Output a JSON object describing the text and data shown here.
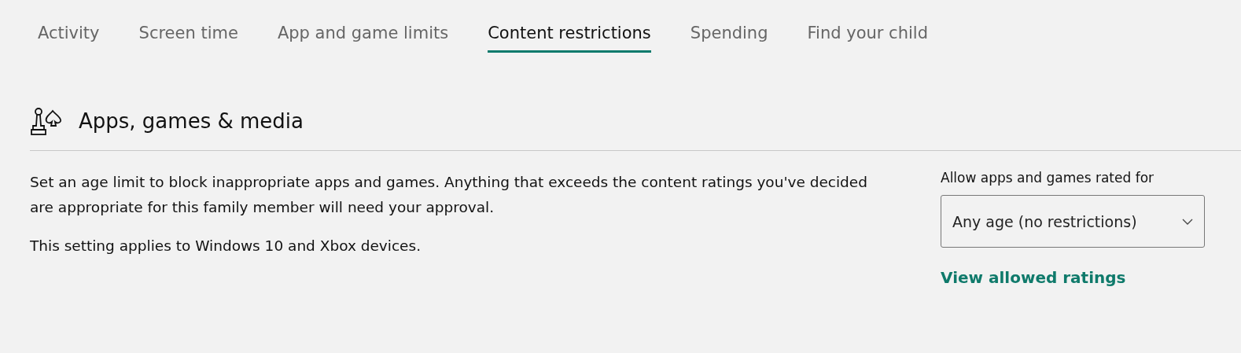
{
  "tabs": [
    {
      "label": "Activity",
      "selected": false
    },
    {
      "label": "Screen time",
      "selected": false
    },
    {
      "label": "App and game limits",
      "selected": false
    },
    {
      "label": "Content restrictions",
      "selected": true
    },
    {
      "label": "Spending",
      "selected": false
    },
    {
      "label": "Find your child",
      "selected": false
    }
  ],
  "section": {
    "title": "Apps, games & media",
    "paragraphs": [
      "Set an age limit to block inappropriate apps and games. Anything that exceeds the content ratings you've decided are appropriate for this family member will need your approval.",
      "This setting applies to Windows 10 and Xbox devices."
    ],
    "age_limit": {
      "label": "Allow apps and games rated for",
      "value": "Any age (no restrictions)"
    },
    "link": "View allowed ratings"
  }
}
